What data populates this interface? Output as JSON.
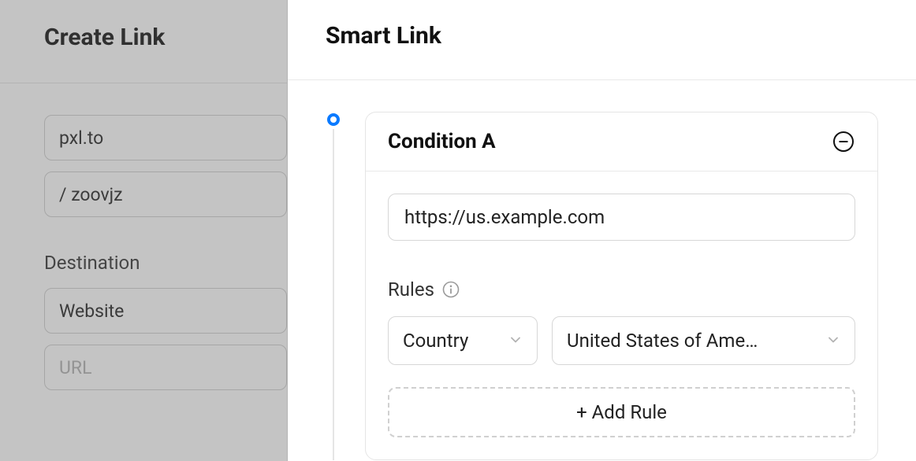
{
  "leftPanel": {
    "title": "Create Link",
    "domainValue": "pxl.to",
    "pathValue": "/ zoovjz",
    "destinationLabel": "Destination",
    "destinationTypeValue": "Website",
    "urlPlaceholder": "URL"
  },
  "rightPanel": {
    "title": "Smart Link",
    "condition": {
      "title": "Condition A",
      "urlValue": "https://us.example.com",
      "rulesLabel": "Rules",
      "rule": {
        "typeLabel": "Country",
        "valueLabel": "United States of Ame…"
      },
      "addRuleLabel": "+ Add Rule"
    }
  }
}
